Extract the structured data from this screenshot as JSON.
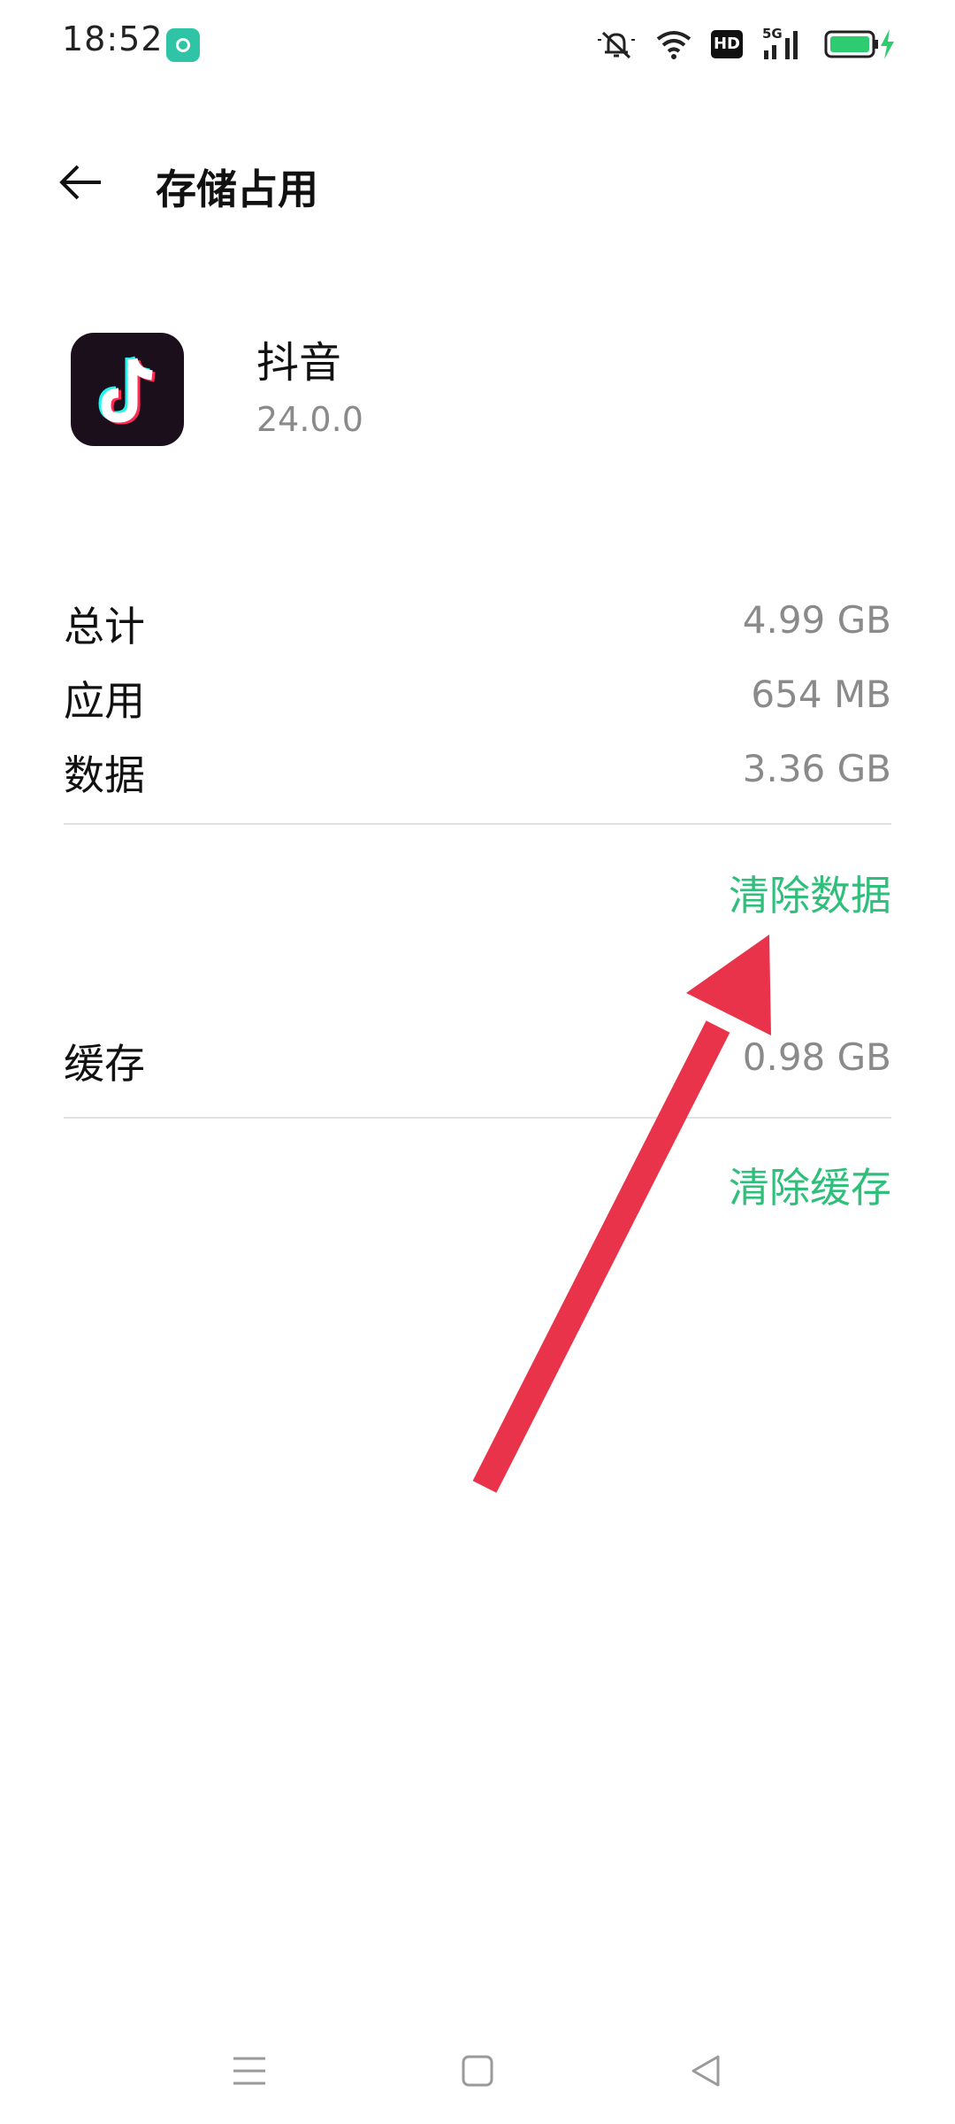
{
  "status_bar": {
    "time": "18:52",
    "notification_icon": "music-app-icon",
    "icons": [
      "mute-icon",
      "wifi-icon",
      "hd-icon",
      "5g-signal-icon",
      "battery-charging-icon"
    ],
    "hd_label": "HD",
    "network_label": "5G",
    "battery_color": "#2ecc71"
  },
  "header": {
    "back_icon": "back-arrow-icon",
    "title": "存储占用"
  },
  "app": {
    "name": "抖音",
    "version": "24.0.0",
    "icon": "tiktok-logo-icon"
  },
  "storage": {
    "total": {
      "label": "总计",
      "value": "4.99 GB"
    },
    "app": {
      "label": "应用",
      "value": "654 MB"
    },
    "data": {
      "label": "数据",
      "value": "3.36 GB"
    },
    "clear_data_label": "清除数据",
    "cache": {
      "label": "缓存",
      "value": "0.98 GB"
    },
    "clear_cache_label": "清除缓存"
  },
  "annotation": {
    "type": "red-arrow",
    "points_to": "清除数据",
    "color": "#e8334a"
  },
  "nav_bar": {
    "buttons": [
      "menu-icon",
      "home-icon",
      "back-triangle-icon"
    ]
  },
  "colors": {
    "accent": "#2fbf7a",
    "secondary_text": "#8a8a8a",
    "divider": "#e2e2e2"
  }
}
